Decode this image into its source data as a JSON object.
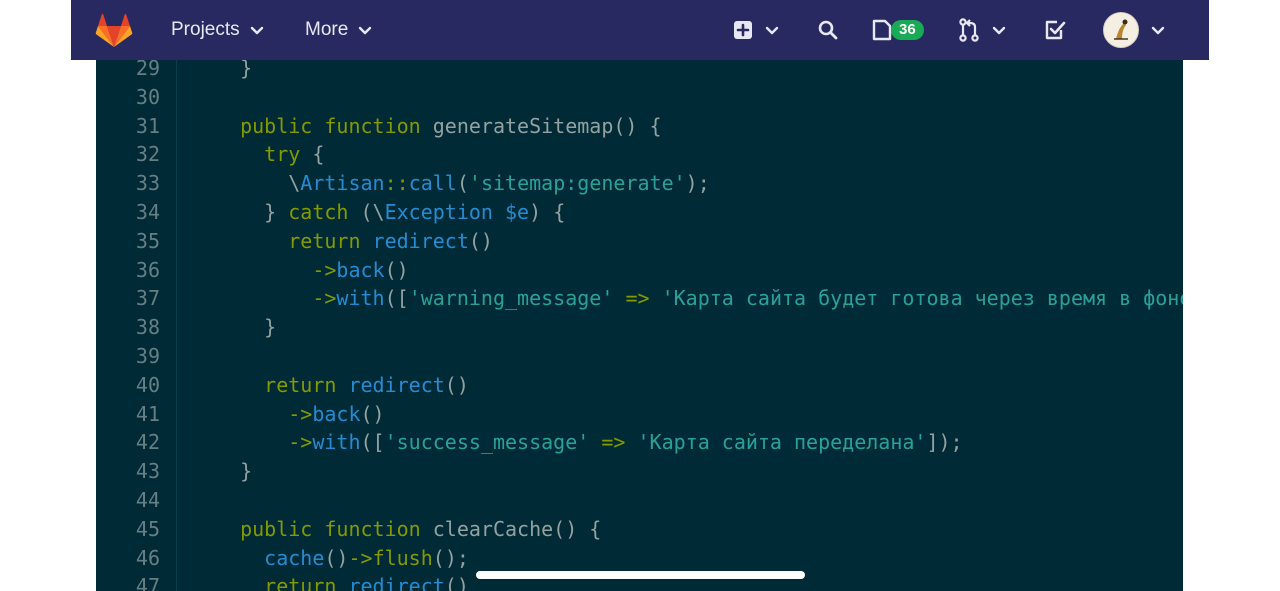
{
  "nav": {
    "projects_label": "Projects",
    "more_label": "More",
    "issues_badge": "36",
    "colors": {
      "background": "#292961",
      "badge": "#1aaa55",
      "logo": "#e24329"
    }
  },
  "code": {
    "theme_colors": {
      "background": "#002b36",
      "keyword": "#859900",
      "function": "#268bd2",
      "string": "#2aa198",
      "plain": "#93a1a1"
    },
    "lines": [
      {
        "n": "29",
        "t": [
          [
            "pl",
            "  }"
          ]
        ]
      },
      {
        "n": "30",
        "t": []
      },
      {
        "n": "31",
        "t": [
          [
            "kw",
            "  public"
          ],
          [
            "pl",
            " "
          ],
          [
            "kw",
            "function"
          ],
          [
            "pl",
            " generateSitemap() {"
          ]
        ]
      },
      {
        "n": "32",
        "t": [
          [
            "kw",
            "    try"
          ],
          [
            "pl",
            " {"
          ]
        ]
      },
      {
        "n": "33",
        "t": [
          [
            "pl",
            "      \\"
          ],
          [
            "fn",
            "Artisan"
          ],
          [
            "op",
            "::"
          ],
          [
            "fn",
            "call"
          ],
          [
            "pl",
            "("
          ],
          [
            "str",
            "'sitemap:generate'"
          ],
          [
            "pl",
            ");"
          ]
        ]
      },
      {
        "n": "34",
        "t": [
          [
            "pl",
            "    } "
          ],
          [
            "kw",
            "catch"
          ],
          [
            "pl",
            " (\\"
          ],
          [
            "fn",
            "Exception"
          ],
          [
            "pl",
            " "
          ],
          [
            "fn",
            "$e"
          ],
          [
            "pl",
            ") {"
          ]
        ]
      },
      {
        "n": "35",
        "t": [
          [
            "kw",
            "      return"
          ],
          [
            "pl",
            " "
          ],
          [
            "fn",
            "redirect"
          ],
          [
            "pl",
            "()"
          ]
        ]
      },
      {
        "n": "36",
        "t": [
          [
            "op",
            "        ->"
          ],
          [
            "fn",
            "back"
          ],
          [
            "pl",
            "()"
          ]
        ]
      },
      {
        "n": "37",
        "t": [
          [
            "op",
            "        ->"
          ],
          [
            "fn",
            "with"
          ],
          [
            "pl",
            "(["
          ],
          [
            "str",
            "'warning_message'"
          ],
          [
            "pl",
            " "
          ],
          [
            "op",
            "=>"
          ],
          [
            "pl",
            " "
          ],
          [
            "str",
            "'Карта сайта будет готова через время в фоновом"
          ]
        ]
      },
      {
        "n": "38",
        "t": [
          [
            "pl",
            "    }"
          ]
        ]
      },
      {
        "n": "39",
        "t": []
      },
      {
        "n": "40",
        "t": [
          [
            "kw",
            "    return"
          ],
          [
            "pl",
            " "
          ],
          [
            "fn",
            "redirect"
          ],
          [
            "pl",
            "()"
          ]
        ]
      },
      {
        "n": "41",
        "t": [
          [
            "op",
            "      ->"
          ],
          [
            "fn",
            "back"
          ],
          [
            "pl",
            "()"
          ]
        ]
      },
      {
        "n": "42",
        "t": [
          [
            "op",
            "      ->"
          ],
          [
            "fn",
            "with"
          ],
          [
            "pl",
            "(["
          ],
          [
            "str",
            "'success_message'"
          ],
          [
            "pl",
            " "
          ],
          [
            "op",
            "=>"
          ],
          [
            "pl",
            " "
          ],
          [
            "str",
            "'Карта сайта переделана'"
          ],
          [
            "pl",
            "]);"
          ]
        ]
      },
      {
        "n": "43",
        "t": [
          [
            "pl",
            "  }"
          ]
        ]
      },
      {
        "n": "44",
        "t": []
      },
      {
        "n": "45",
        "t": [
          [
            "kw",
            "  public"
          ],
          [
            "pl",
            " "
          ],
          [
            "kw",
            "function"
          ],
          [
            "pl",
            " clearCache() {"
          ]
        ]
      },
      {
        "n": "46",
        "t": [
          [
            "fn",
            "    cache"
          ],
          [
            "pl",
            "()"
          ],
          [
            "op",
            "->"
          ],
          [
            "kw",
            "flush"
          ],
          [
            "pl",
            "();"
          ]
        ]
      },
      {
        "n": "47",
        "t": [
          [
            "kw",
            "    return"
          ],
          [
            "pl",
            " "
          ],
          [
            "fn",
            "redirect"
          ],
          [
            "pl",
            "()"
          ]
        ]
      }
    ]
  }
}
